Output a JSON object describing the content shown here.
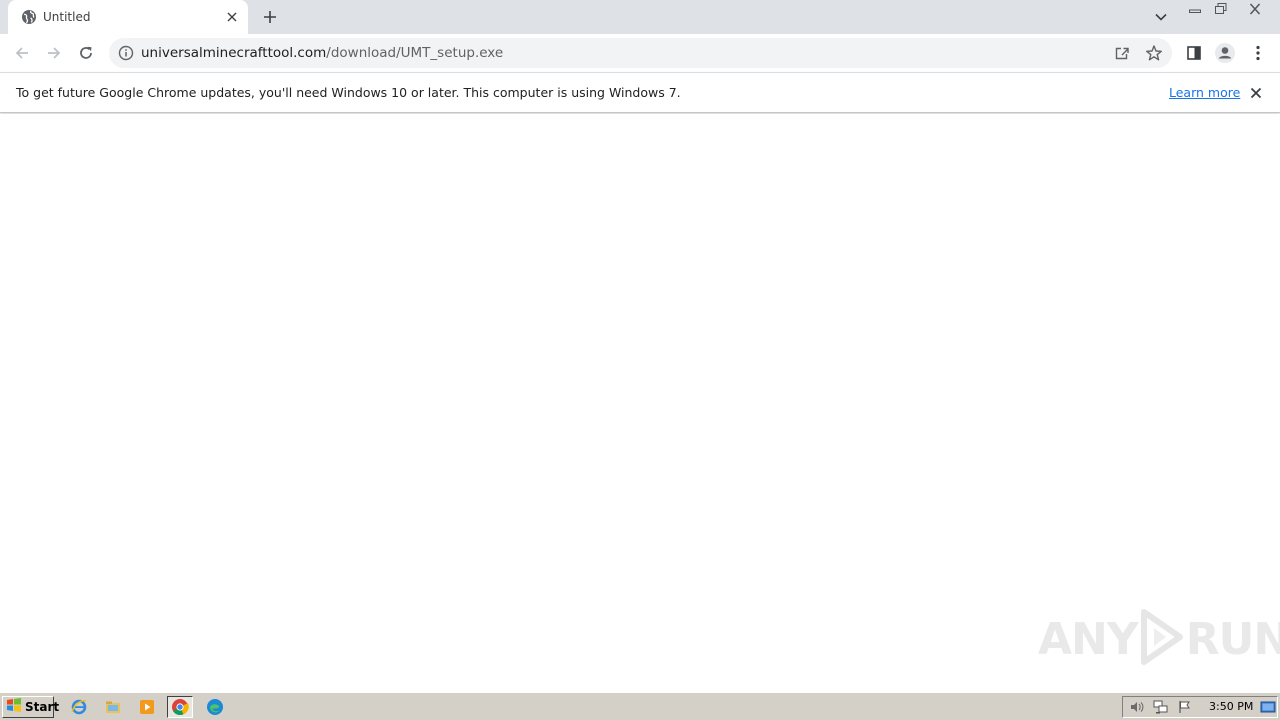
{
  "browser": {
    "tab": {
      "title": "Untitled"
    },
    "omnibox": {
      "url_host": "universalminecrafttool.com",
      "url_path": "/download/UMT_setup.exe"
    },
    "infobar": {
      "message": "To get future Google Chrome updates, you'll need Windows 10 or later. This computer is using Windows 7.",
      "link_label": "Learn more"
    }
  },
  "watermark": {
    "left": "ANY",
    "right": "RUN"
  },
  "taskbar": {
    "start_label": "Start",
    "apps": [
      "internet-explorer-icon",
      "file-explorer-icon",
      "media-player-icon",
      "chrome-icon",
      "edge-icon"
    ],
    "clock": "3:50 PM"
  },
  "colors": {
    "tabstrip": "#dee1e6",
    "omnibox": "#f1f3f4",
    "link": "#1a73e8",
    "taskbar": "#d4d0c8"
  }
}
